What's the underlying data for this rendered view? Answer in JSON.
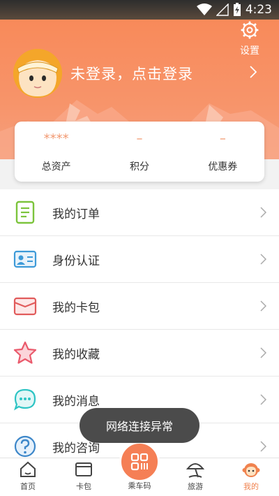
{
  "status_bar": {
    "time": "4:23"
  },
  "header": {
    "settings_label": "设置",
    "login_text": "未登录，点击登录"
  },
  "stats": [
    {
      "value": "****",
      "label": "总资产"
    },
    {
      "value": "–",
      "label": "积分"
    },
    {
      "value": "–",
      "label": "优惠券"
    }
  ],
  "menu": [
    {
      "label": "我的订单",
      "icon": "order-icon"
    },
    {
      "label": "身份认证",
      "icon": "id-card-icon"
    },
    {
      "label": "我的卡包",
      "icon": "wallet-icon"
    },
    {
      "label": "我的收藏",
      "icon": "star-icon"
    },
    {
      "label": "我的消息",
      "icon": "message-icon"
    },
    {
      "label": "我的咨询",
      "icon": "question-icon"
    }
  ],
  "toast": "网络连接异常",
  "nav": [
    {
      "label": "首页",
      "icon": "home-icon"
    },
    {
      "label": "卡包",
      "icon": "card-icon"
    },
    {
      "label": "乘车码",
      "icon": "qr-code-icon"
    },
    {
      "label": "旅游",
      "icon": "umbrella-icon"
    },
    {
      "label": "我的",
      "icon": "monkey-icon"
    }
  ],
  "colors": {
    "accent": "#f57f55",
    "header": "#f88a5a"
  }
}
